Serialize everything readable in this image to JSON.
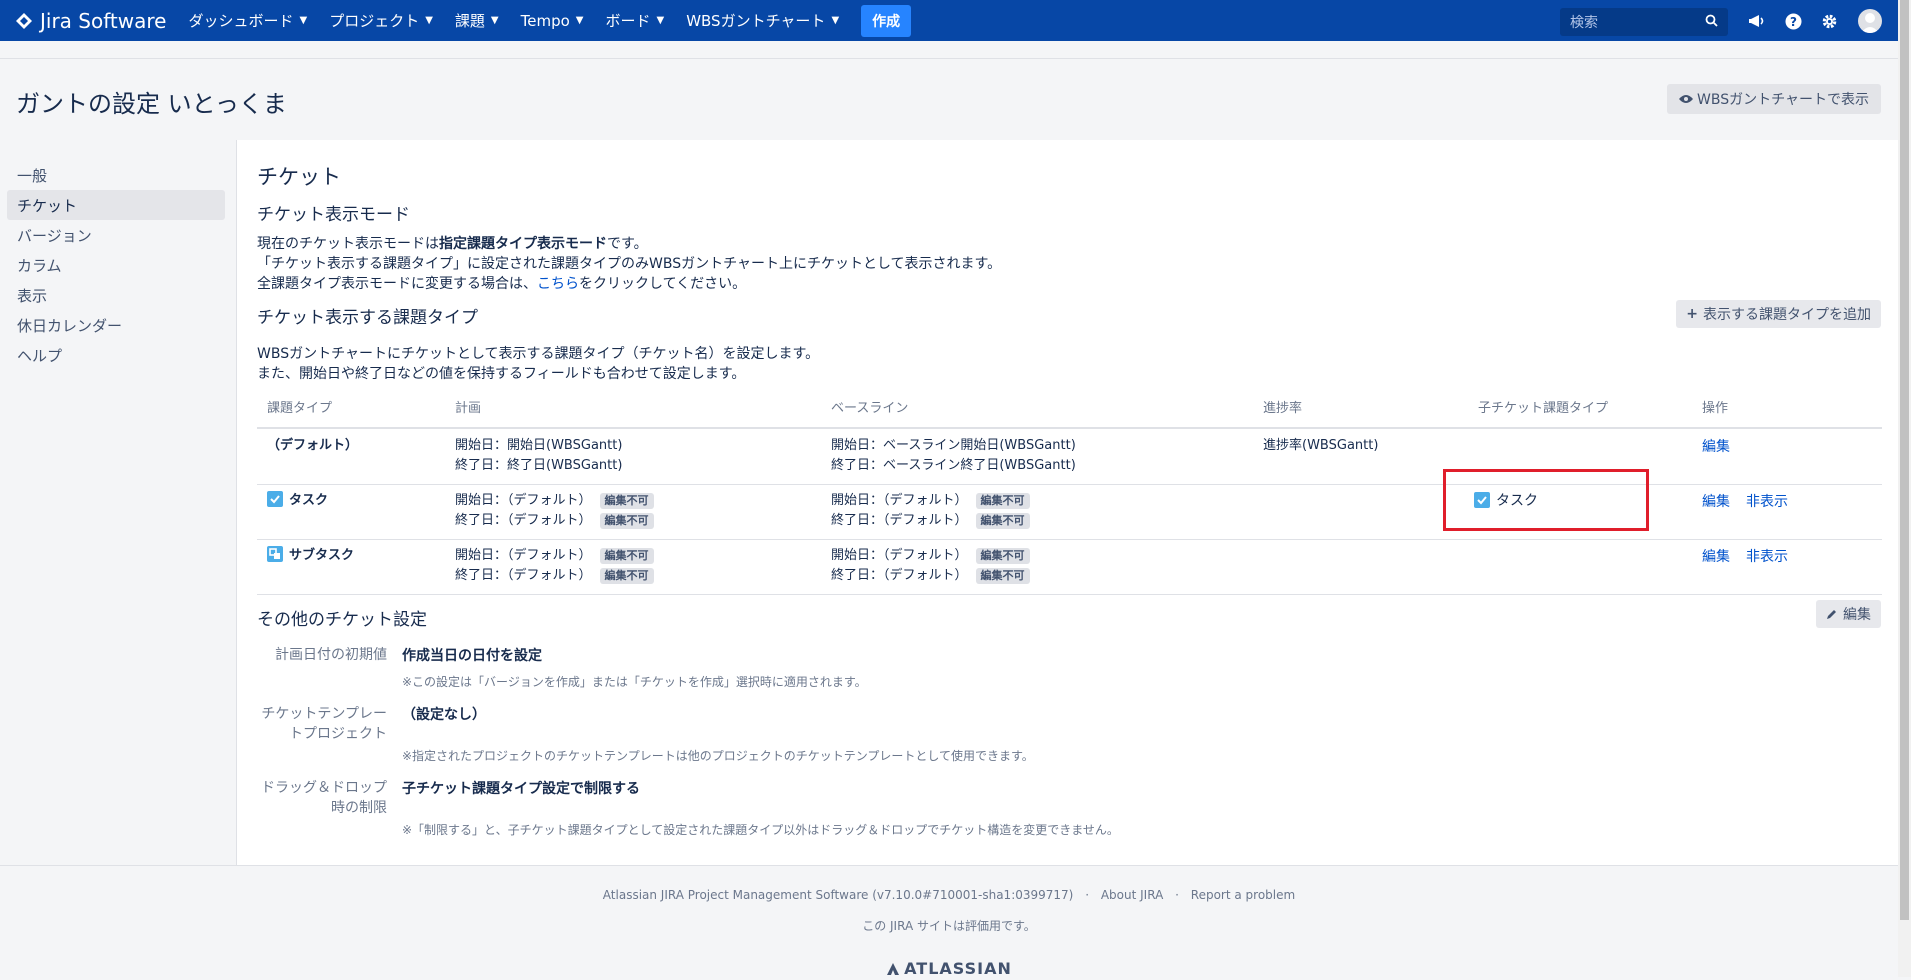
{
  "nav": {
    "logo_text": "Jira Software",
    "items": [
      "ダッシュボード",
      "プロジェクト",
      "課題",
      "Tempo",
      "ボード",
      "WBSガントチャート"
    ],
    "create_label": "作成",
    "search_placeholder": "検索"
  },
  "header": {
    "title": "ガントの設定 いとっくま",
    "wbs_button": "WBSガントチャートで表示"
  },
  "sidebar": {
    "items": [
      "一般",
      "チケット",
      "バージョン",
      "カラム",
      "表示",
      "休日カレンダー",
      "ヘルプ"
    ],
    "active": "チケット"
  },
  "main": {
    "heading": "チケット",
    "mode_heading": "チケット表示モード",
    "mode_text_prefix": "現在のチケット表示モードは",
    "mode_text_bold": "指定課題タイプ表示モード",
    "mode_text_suffix": "です。",
    "mode_text_2": "「チケット表示する課題タイプ」に設定された課題タイプのみWBSガントチャート上にチケットとして表示されます。",
    "mode_text_3_prefix": "全課題タイプ表示モードに変更する場合は、",
    "mode_text_3_link": "こちら",
    "mode_text_3_suffix": "をクリックしてください。",
    "types_heading": "チケット表示する課題タイプ",
    "add_type_button": "表示する課題タイプを追加",
    "types_desc_1": "WBSガントチャートにチケットとして表示する課題タイプ（チケット名）を設定します。",
    "types_desc_2": "また、開始日や終了日などの値を保持するフィールドも合わせて設定します。"
  },
  "table": {
    "headers": [
      "課題タイプ",
      "計画",
      "ベースライン",
      "進捗率",
      "子チケット課題タイプ",
      "操作"
    ],
    "rows": [
      {
        "type": "（デフォルト）",
        "plan_start": "開始日：開始日(WBSGantt)",
        "plan_end": "終了日：終了日(WBSGantt)",
        "base_start": "開始日：ベースライン開始日(WBSGantt)",
        "base_end": "終了日：ベースライン終了日(WBSGantt)",
        "progress": "進捗率(WBSGantt)",
        "child": "",
        "edit": "編集",
        "hide": ""
      },
      {
        "type": "タスク",
        "plan_start": "開始日：（デフォルト）",
        "plan_end": "終了日：（デフォルト）",
        "base_start": "開始日：（デフォルト）",
        "base_end": "終了日：（デフォルト）",
        "progress": "",
        "child": "タスク",
        "edit": "編集",
        "hide": "非表示"
      },
      {
        "type": "サブタスク",
        "plan_start": "開始日：（デフォルト）",
        "plan_end": "終了日：（デフォルト）",
        "base_start": "開始日：（デフォルト）",
        "base_end": "終了日：（デフォルト）",
        "progress": "",
        "child": "",
        "edit": "編集",
        "hide": "非表示"
      }
    ],
    "lozenge": "編集不可"
  },
  "other": {
    "heading": "その他のチケット設定",
    "edit_button": "編集",
    "fields": [
      {
        "label": "計画日付の初期値",
        "value": "作成当日の日付を設定",
        "note": "※この設定は「バージョンを作成」または「チケットを作成」選択時に適用されます。"
      },
      {
        "label_1": "チケットテンプレー",
        "label_2": "トプロジェクト",
        "value": "（設定なし）",
        "note": "※指定されたプロジェクトのチケットテンプレートは他のプロジェクトのチケットテンプレートとして使用できます。"
      },
      {
        "label_1": "ドラッグ＆ドロップ",
        "label_2": "時の制限",
        "value": "子チケット課題タイプ設定で制限する",
        "note": "※「制限する」と、子チケット課題タイプとして設定された課題タイプ以外はドラッグ＆ドロップでチケット構造を変更できません。"
      }
    ]
  },
  "footer": {
    "line1_a": "Atlassian JIRA Project Management Software (v7.10.0#710001-sha1:0399717)",
    "line1_sep": "·",
    "line1_b": "About JIRA",
    "line1_c": "Report a problem",
    "line2": "この JIRA サイトは評価用です。",
    "logo": "ATLASSIAN"
  },
  "colors": {
    "nav_bg": "#0747a6",
    "link": "#0052cc",
    "task_icon": "#4bade8",
    "highlight_box": "#e01e2b"
  }
}
